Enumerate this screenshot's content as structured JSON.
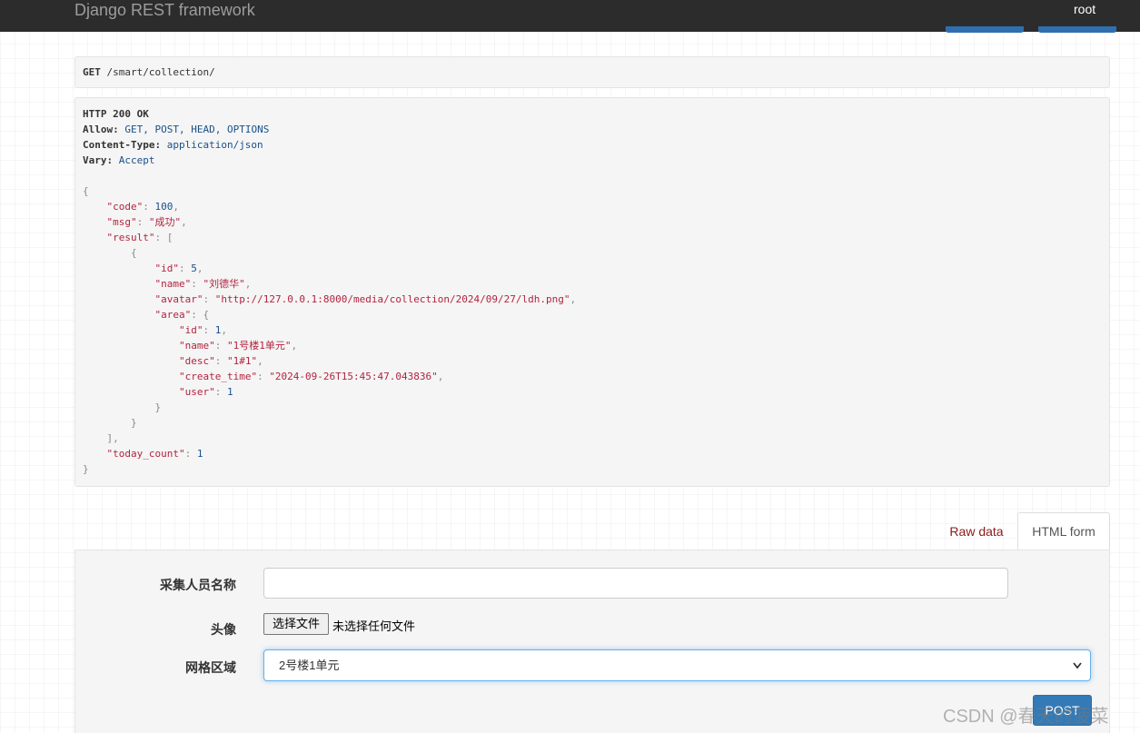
{
  "navbar": {
    "brand": "Django REST framework",
    "user": "root"
  },
  "request": {
    "method": "GET",
    "path": "/smart/collection/"
  },
  "response": {
    "status": "HTTP 200 OK",
    "headers": [
      {
        "name": "Allow:",
        "value": "GET, POST, HEAD, OPTIONS"
      },
      {
        "name": "Content-Type:",
        "value": "application/json"
      },
      {
        "name": "Vary:",
        "value": "Accept"
      }
    ],
    "body": {
      "code": "100",
      "msg": "\"成功\"",
      "id": "5",
      "name": "\"刘德华\"",
      "avatar": "\"http://127.0.0.1:8000/media/collection/2024/09/27/ldh.png\"",
      "area_id": "1",
      "area_name": "\"1号楼1单元\"",
      "area_desc": "\"1#1\"",
      "area_create_time": "\"2024-09-26T15:45:47.043836\"",
      "area_user": "1",
      "today_count": "1"
    }
  },
  "tabs": {
    "raw": "Raw data",
    "html": "HTML form"
  },
  "form": {
    "name_label": "采集人员名称",
    "avatar_label": "头像",
    "file_button": "选择文件",
    "file_status": "未选择任何文件",
    "area_label": "网格区域",
    "area_value": "2号楼1单元",
    "post_button": "POST"
  },
  "watermark": "CSDN @春天的菠菜"
}
